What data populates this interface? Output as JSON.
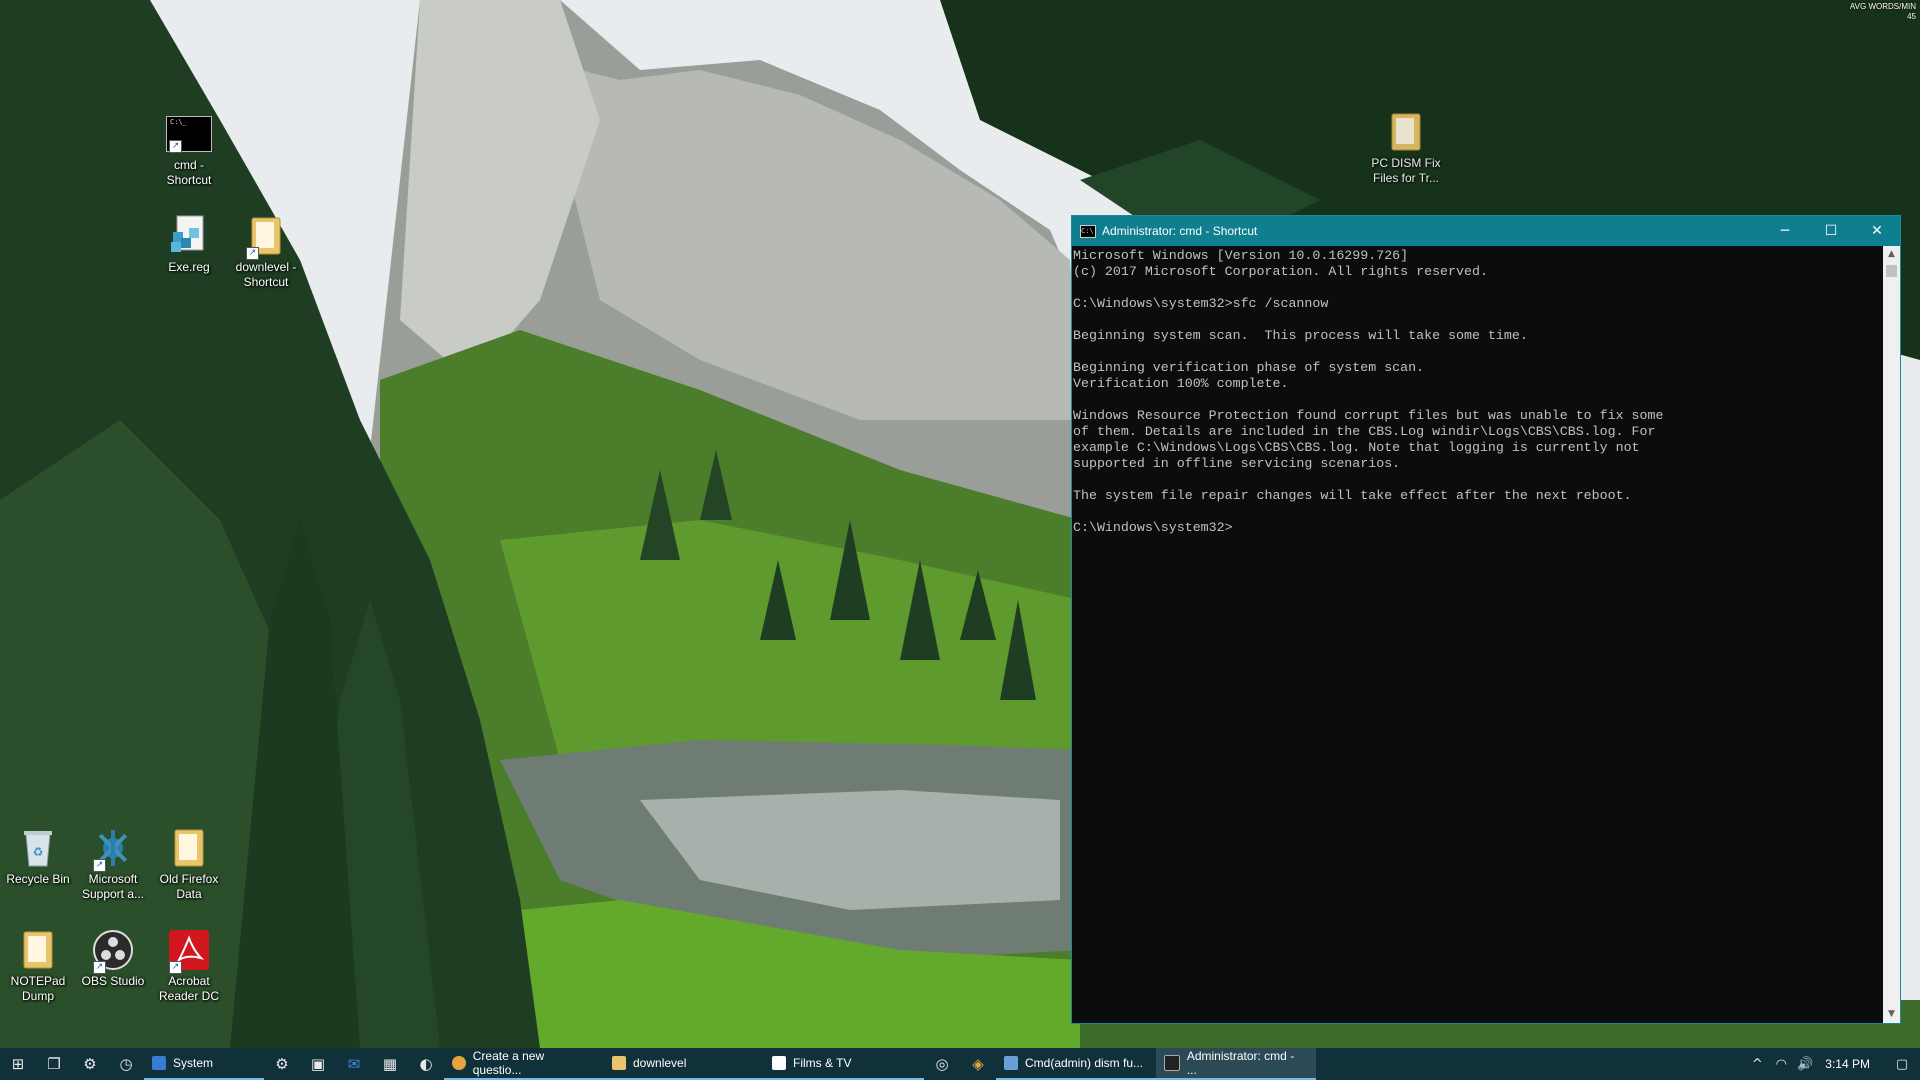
{
  "desktop": {
    "corner_overlay": "AVG WORDS/MIN\n45",
    "icons": [
      {
        "label": "cmd - Shortcut"
      },
      {
        "label": "Exe.reg"
      },
      {
        "label": "downlevel - Shortcut"
      },
      {
        "label": "PC DISM Fix Files for Tr..."
      },
      {
        "label": "Recycle Bin"
      },
      {
        "label": "Microsoft Support a..."
      },
      {
        "label": "Old Firefox Data"
      },
      {
        "label": "NOTEPad Dump"
      },
      {
        "label": "OBS Studio"
      },
      {
        "label": "Acrobat Reader DC"
      }
    ]
  },
  "cmd_window": {
    "title": "Administrator: cmd - Shortcut",
    "icon": "console-icon",
    "controls": {
      "minimize": "─",
      "maximize": "☐",
      "close": "✕"
    },
    "console_text": "Microsoft Windows [Version 10.0.16299.726]\n(c) 2017 Microsoft Corporation. All rights reserved.\n\nC:\\Windows\\system32>sfc /scannow\n\nBeginning system scan.  This process will take some time.\n\nBeginning verification phase of system scan.\nVerification 100% complete.\n\nWindows Resource Protection found corrupt files but was unable to fix some\nof them. Details are included in the CBS.Log windir\\Logs\\CBS\\CBS.log. For\nexample C:\\Windows\\Logs\\CBS\\CBS.log. Note that logging is currently not\nsupported in offline servicing scenarios.\n\nThe system file repair changes will take effect after the next reboot.\n\nC:\\Windows\\system32>"
  },
  "taskbar": {
    "pinned": [
      {
        "name": "start-button",
        "glyph": "⊞"
      },
      {
        "name": "task-view",
        "glyph": "❐"
      },
      {
        "name": "settings-gear",
        "glyph": "⚙"
      },
      {
        "name": "clock-app",
        "glyph": "◷"
      }
    ],
    "apps": [
      {
        "label": "System",
        "color": "#3a7bd5"
      },
      {
        "label": "Create a new questio...",
        "color": "#e8a33d"
      },
      {
        "label": "downlevel",
        "color": "#e8c46a"
      },
      {
        "label": "Films & TV",
        "color": "#ffffff"
      },
      {
        "label": "Cmd(admin) dism fu...",
        "color": "#6aa0d8"
      },
      {
        "label": "Administrator: cmd - ...",
        "color": "#222222"
      }
    ],
    "extra_icons": [
      "⚙",
      "▣",
      "✉",
      "▦",
      "◐",
      "◎",
      "◈"
    ],
    "tray": {
      "chevron": "^",
      "network": "◠",
      "volume": "🔊",
      "time": "3:14 PM",
      "notifications": "▢"
    }
  }
}
